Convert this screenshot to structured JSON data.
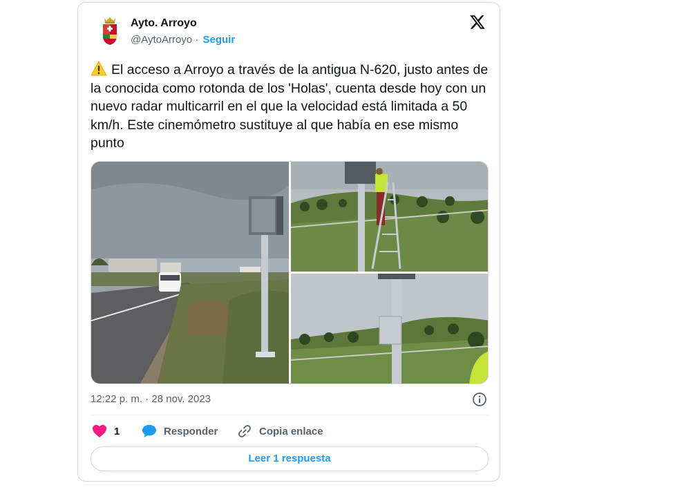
{
  "account": {
    "name": "Ayto. Arroyo",
    "handle": "@AytoArroyo",
    "separator": " · ",
    "follow_label": "Seguir"
  },
  "tweet": {
    "text": "El acceso a Arroyo a través de la antigua N-620, justo antes de la conocida como rotonda de los 'Holas', cuenta desde hoy con un nuevo radar multicarril en el que la velocidad está limitada a 50 km/h. Este cinemómetro sustituye al que había en ese mismo punto",
    "timestamp": "12:22 p. m. · 28 nov. 2023"
  },
  "actions": {
    "like_count": "1",
    "reply_label": "Responder",
    "copy_link_label": "Copia enlace"
  },
  "read_replies_label": "Leer 1 respuesta",
  "colors": {
    "like": "#f91880",
    "reply_bubble": "#1d9bf0",
    "link": "#1d9bf0",
    "muted": "#536471",
    "border": "#cfd9de"
  },
  "icons": {
    "brand": "x-logo-icon",
    "warning": "warning-icon",
    "like": "heart-icon",
    "reply": "speech-bubble-icon",
    "copy_link": "link-icon",
    "info": "info-icon"
  }
}
